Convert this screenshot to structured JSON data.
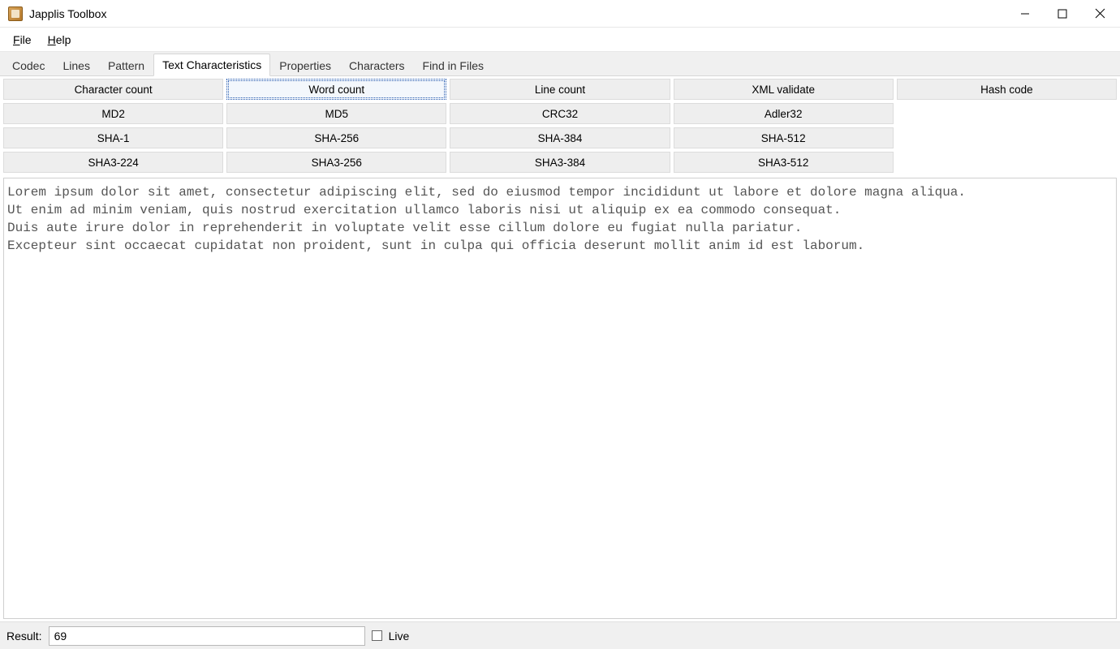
{
  "window": {
    "title": "Japplis Toolbox"
  },
  "menu": {
    "file": "File",
    "help": "Help"
  },
  "tabs": {
    "codec": "Codec",
    "lines": "Lines",
    "pattern": "Pattern",
    "text_characteristics": "Text Characteristics",
    "properties": "Properties",
    "characters": "Characters",
    "find_in_files": "Find in Files",
    "active": "text_characteristics"
  },
  "actions": {
    "row0": [
      "Character count",
      "Word count",
      "Line count",
      "XML validate",
      "Hash code"
    ],
    "row1": [
      "MD2",
      "MD5",
      "CRC32",
      "Adler32",
      ""
    ],
    "row2": [
      "SHA-1",
      "SHA-256",
      "SHA-384",
      "SHA-512",
      ""
    ],
    "row3": [
      "SHA3-224",
      "SHA3-256",
      "SHA3-384",
      "SHA3-512",
      ""
    ],
    "selected": "Word count"
  },
  "text_content": "Lorem ipsum dolor sit amet, consectetur adipiscing elit, sed do eiusmod tempor incididunt ut labore et dolore magna aliqua.\nUt enim ad minim veniam, quis nostrud exercitation ullamco laboris nisi ut aliquip ex ea commodo consequat.\nDuis aute irure dolor in reprehenderit in voluptate velit esse cillum dolore eu fugiat nulla pariatur.\nExcepteur sint occaecat cupidatat non proident, sunt in culpa qui officia deserunt mollit anim id est laborum.",
  "status": {
    "result_label": "Result:",
    "result_value": "69",
    "live_label": "Live",
    "live_checked": false
  }
}
